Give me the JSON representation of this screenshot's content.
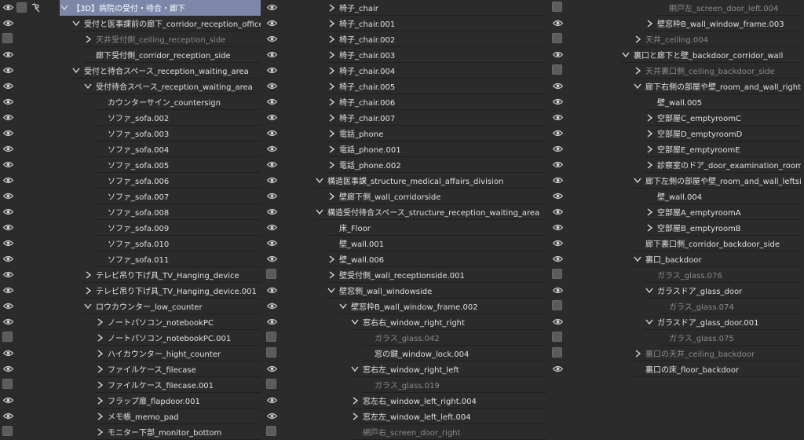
{
  "colors": {
    "selected": "#7c87a9",
    "background": "#2b2b2b",
    "text": "#e0e0e0",
    "dim_text": "#8a8a8a"
  },
  "columns": [
    [
      {
        "label": "【3D】病院の受付・待合・廊下",
        "indent": 0,
        "arrow": "down",
        "selected": true
      },
      {
        "label": "受付と医事課前の廊下_corridor_reception_office",
        "indent": 1,
        "arrow": "down"
      },
      {
        "label": "天井受付側_ceiling_reception_side",
        "indent": 2,
        "arrow": "right",
        "hidden": true,
        "dim": true
      },
      {
        "label": "廊下受付側_corridor_reception_side",
        "indent": 2,
        "arrow": "none"
      },
      {
        "label": "受付と待合スペース_reception_waiting_area",
        "indent": 1,
        "arrow": "down"
      },
      {
        "label": "受付待合スペース_reception_waiting_area",
        "indent": 2,
        "arrow": "down"
      },
      {
        "label": "カウンターサイン_countersign",
        "indent": 3,
        "arrow": "none"
      },
      {
        "label": "ソファ_sofa.002",
        "indent": 3,
        "arrow": "none"
      },
      {
        "label": "ソファ_sofa.003",
        "indent": 3,
        "arrow": "none"
      },
      {
        "label": "ソファ_sofa.004",
        "indent": 3,
        "arrow": "none"
      },
      {
        "label": "ソファ_sofa.005",
        "indent": 3,
        "arrow": "none"
      },
      {
        "label": "ソファ_sofa.006",
        "indent": 3,
        "arrow": "none"
      },
      {
        "label": "ソファ_sofa.007",
        "indent": 3,
        "arrow": "none"
      },
      {
        "label": "ソファ_sofa.008",
        "indent": 3,
        "arrow": "none"
      },
      {
        "label": "ソファ_sofa.009",
        "indent": 3,
        "arrow": "none"
      },
      {
        "label": "ソファ_sofa.010",
        "indent": 3,
        "arrow": "none"
      },
      {
        "label": "ソファ_sofa.011",
        "indent": 3,
        "arrow": "none"
      },
      {
        "label": "テレビ吊り下げ具_TV_Hanging_device",
        "indent": 2,
        "arrow": "right"
      },
      {
        "label": "テレビ吊り下げ具_TV_Hanging_device.001",
        "indent": 2,
        "arrow": "right"
      },
      {
        "label": "ロウカウンター_low_counter",
        "indent": 2,
        "arrow": "down"
      },
      {
        "label": "ノートパソコン_notebookPC",
        "indent": 3,
        "arrow": "right"
      },
      {
        "label": "ノートパソコン_notebookPC.001",
        "indent": 3,
        "arrow": "right",
        "hidden": true
      },
      {
        "label": "ハイカウンター_hight_counter",
        "indent": 3,
        "arrow": "right"
      },
      {
        "label": "ファイルケース_filecase",
        "indent": 3,
        "arrow": "right"
      },
      {
        "label": "ファイルケース_filecase.001",
        "indent": 3,
        "arrow": "right",
        "hidden": true
      },
      {
        "label": "フラップ扉_flapdoor.001",
        "indent": 3,
        "arrow": "right"
      },
      {
        "label": "メモ帳_memo_pad",
        "indent": 3,
        "arrow": "right"
      },
      {
        "label": "モニター下部_monitor_bottom",
        "indent": 3,
        "arrow": "right",
        "hidden": true
      }
    ],
    [
      {
        "label": "椅子_chair",
        "indent": 0,
        "arrow": "right"
      },
      {
        "label": "椅子_chair.001",
        "indent": 0,
        "arrow": "right"
      },
      {
        "label": "椅子_chair.002",
        "indent": 0,
        "arrow": "right"
      },
      {
        "label": "椅子_chair.003",
        "indent": 0,
        "arrow": "right"
      },
      {
        "label": "椅子_chair.004",
        "indent": 0,
        "arrow": "right"
      },
      {
        "label": "椅子_chair.005",
        "indent": 0,
        "arrow": "right"
      },
      {
        "label": "椅子_chair.006",
        "indent": 0,
        "arrow": "right"
      },
      {
        "label": "椅子_chair.007",
        "indent": 0,
        "arrow": "right"
      },
      {
        "label": "電話_phone",
        "indent": 0,
        "arrow": "right"
      },
      {
        "label": "電話_phone.001",
        "indent": 0,
        "arrow": "right"
      },
      {
        "label": "電話_phone.002",
        "indent": 0,
        "arrow": "right"
      },
      {
        "label": "構造医事課_structure_medical_affairs_division",
        "indent": -1,
        "arrow": "down"
      },
      {
        "label": "壁廊下側_wall_corridorside",
        "indent": 0,
        "arrow": "right"
      },
      {
        "label": "構造受付待合スペース_structure_reception_waiting_area",
        "indent": -1,
        "arrow": "down"
      },
      {
        "label": "床_Floor",
        "indent": 0,
        "arrow": "none"
      },
      {
        "label": "壁_wall.001",
        "indent": 0,
        "arrow": "none"
      },
      {
        "label": "壁_wall.006",
        "indent": 0,
        "arrow": "right"
      },
      {
        "label": "壁受付側_wall_receptionside.001",
        "indent": 0,
        "arrow": "right",
        "hidden": true
      },
      {
        "label": "壁窓側_wall_windowside",
        "indent": 0,
        "arrow": "down"
      },
      {
        "label": "壁窓枠B_wall_window_frame.002",
        "indent": 1,
        "arrow": "down"
      },
      {
        "label": "窓右右_window_right_right",
        "indent": 2,
        "arrow": "down"
      },
      {
        "label": "ガラス_glass.042",
        "indent": 3,
        "arrow": "none",
        "hidden": true,
        "dim": true
      },
      {
        "label": "窓の鍵_window_lock.004",
        "indent": 3,
        "arrow": "none",
        "hidden": true
      },
      {
        "label": "窓右左_window_right_left",
        "indent": 2,
        "arrow": "down"
      },
      {
        "label": "ガラス_glass.019",
        "indent": 3,
        "arrow": "none",
        "hidden": true,
        "dim": true
      },
      {
        "label": "窓左右_window_left_right.004",
        "indent": 2,
        "arrow": "right"
      },
      {
        "label": "窓左左_window_left_left.004",
        "indent": 2,
        "arrow": "right"
      },
      {
        "label": "網戸右_screen_door_right",
        "indent": 2,
        "arrow": "none",
        "hidden": true,
        "dim": true
      }
    ],
    [
      {
        "label": "網戸左_screen_door_left.004",
        "indent": 4,
        "arrow": "none",
        "hidden": true,
        "dim": true
      },
      {
        "label": "壁窓枠B_wall_window_frame.003",
        "indent": 3,
        "arrow": "right"
      },
      {
        "label": "天井_ceiling.004",
        "indent": 2,
        "arrow": "right",
        "hidden": true,
        "dim": true
      },
      {
        "label": "裏口と廊下と壁_backdoor_corridor_wall",
        "indent": 1,
        "arrow": "down"
      },
      {
        "label": "天井裏口側_ceiling_backdoor_side",
        "indent": 2,
        "arrow": "right",
        "hidden": true,
        "dim": true
      },
      {
        "label": "廊下右側の部屋や壁_room_and_wall_rightside",
        "indent": 2,
        "arrow": "down"
      },
      {
        "label": "壁_wall.005",
        "indent": 3,
        "arrow": "none"
      },
      {
        "label": "空部屋C_emptyroomC",
        "indent": 3,
        "arrow": "right"
      },
      {
        "label": "空部屋D_emptyroomD",
        "indent": 3,
        "arrow": "right"
      },
      {
        "label": "空部屋E_emptyroomE",
        "indent": 3,
        "arrow": "right"
      },
      {
        "label": "診察室のドア_door_examination_room",
        "indent": 3,
        "arrow": "right"
      },
      {
        "label": "廊下左側の部屋や壁_room_and_wall_leftside",
        "indent": 2,
        "arrow": "down"
      },
      {
        "label": "壁_wall.004",
        "indent": 3,
        "arrow": "none"
      },
      {
        "label": "空部屋A_emptyroomA",
        "indent": 3,
        "arrow": "right"
      },
      {
        "label": "空部屋B_emptyroomB",
        "indent": 3,
        "arrow": "right"
      },
      {
        "label": "廊下裏口側_corridor_backdoor_side",
        "indent": 2,
        "arrow": "none"
      },
      {
        "label": "裏口_backdoor",
        "indent": 2,
        "arrow": "down"
      },
      {
        "label": "ガラス_glass.076",
        "indent": 3,
        "arrow": "none",
        "hidden": true,
        "dim": true
      },
      {
        "label": "ガラスドア_glass_door",
        "indent": 3,
        "arrow": "down"
      },
      {
        "label": "ガラス_glass.074",
        "indent": 4,
        "arrow": "none",
        "hidden": true,
        "dim": true
      },
      {
        "label": "ガラスドア_glass_door.001",
        "indent": 3,
        "arrow": "down"
      },
      {
        "label": "ガラス_glass.075",
        "indent": 4,
        "arrow": "none",
        "hidden": true,
        "dim": true
      },
      {
        "label": "裏口の天井_ceiling_backdoor",
        "indent": 2,
        "arrow": "right",
        "hidden": true,
        "dim": true
      },
      {
        "label": "裏口の床_floor_backdoor",
        "indent": 2,
        "arrow": "none"
      }
    ]
  ]
}
